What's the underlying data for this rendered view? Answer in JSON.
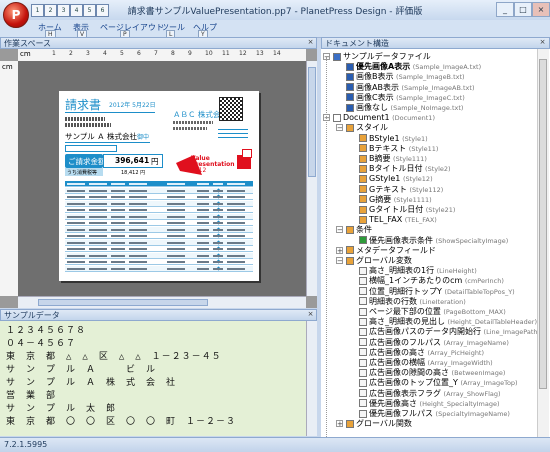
{
  "window": {
    "title": "請求書サンプルValuePresentation.pp7 - PlanetPress Design - 評価版",
    "quick_access": [
      "1",
      "2",
      "3",
      "4",
      "5",
      "6"
    ],
    "controls": [
      "_",
      "□",
      "×"
    ]
  },
  "ribbon": {
    "tabs": [
      {
        "label": "ホーム",
        "key": "H"
      },
      {
        "label": "表示",
        "key": "V"
      },
      {
        "label": "ページレイアウト",
        "key": "P"
      },
      {
        "label": "ツール",
        "key": "L"
      },
      {
        "label": "ヘルプ",
        "key": "Y"
      }
    ]
  },
  "workspace": {
    "title": "作業スペース",
    "ruler_unit": "cm",
    "ruler_marks": [
      "1",
      "2",
      "3",
      "4",
      "5",
      "6",
      "7",
      "8",
      "9",
      "10",
      "11",
      "12",
      "13",
      "14"
    ]
  },
  "invoice": {
    "title": "請求書",
    "date": "2012年 5月22日",
    "company": "ＡＢＣ 株式会社",
    "customer": "サンプル Ａ 株式会社",
    "honorific": "御中",
    "total_label": "ご請求金額",
    "total_value": "396,641",
    "total_unit": "円",
    "tax_label": "うち消費税等",
    "tax_value": "18,412 円",
    "brand_line1": "Value",
    "brand_line2": "Presentation",
    "brand_year": "2012"
  },
  "sample_data": {
    "title": "サンプルデータ",
    "lines": [
      "１２３４５６７８",
      "０４－４５６７",
      "東　京　都　△　△　区　△　△　１－２３－４５",
      "サ　ン　プ　ル　Ａ　　　ビ　ル",
      "サ　ン　プ　ル　Ａ　株　式　会　社",
      "営　業　部",
      "サ　ン　プ　ル　太　郎",
      "東　京　都　〇　〇　区　〇　〇　町　１－２－３"
    ]
  },
  "tree": {
    "title": "ドキュメント構造",
    "nodes": [
      {
        "label": "サンプルデータファイル",
        "sub": "",
        "level": 0,
        "icon": "folder-icon",
        "exp": "−"
      },
      {
        "label": "優先画像A表示",
        "sub": "(Sample_ImageA.txt)",
        "level": 1,
        "icon": "datafile-icon",
        "bold": true
      },
      {
        "label": "画像B表示",
        "sub": "(Sample_ImageB.txt)",
        "level": 1,
        "icon": "datafile-icon"
      },
      {
        "label": "画像AB表示",
        "sub": "(Sample_ImageAB.txt)",
        "level": 1,
        "icon": "datafile-icon"
      },
      {
        "label": "画像C表示",
        "sub": "(Sample_ImageC.txt)",
        "level": 1,
        "icon": "datafile-icon"
      },
      {
        "label": "画像なし",
        "sub": "(Sample_NoImage.txt)",
        "level": 1,
        "icon": "datafile-icon"
      },
      {
        "label": "Document1",
        "sub": "(Document1)",
        "level": 0,
        "icon": "document-icon",
        "exp": "−"
      },
      {
        "label": "スタイル",
        "sub": "",
        "level": 1,
        "icon": "style-folder-icon",
        "exp": "−"
      },
      {
        "label": "BStyle1",
        "sub": "(Style1)",
        "level": 2,
        "icon": "style-icon"
      },
      {
        "label": "Bテキスト",
        "sub": "(Style11)",
        "level": 2,
        "icon": "style-icon"
      },
      {
        "label": "B摘要",
        "sub": "(Style111)",
        "level": 2,
        "icon": "style-icon"
      },
      {
        "label": "Bタイトル日付",
        "sub": "(Style2)",
        "level": 2,
        "icon": "style-icon"
      },
      {
        "label": "GStyle1",
        "sub": "(Style12)",
        "level": 2,
        "icon": "style-icon"
      },
      {
        "label": "Gテキスト",
        "sub": "(Style112)",
        "level": 2,
        "icon": "style-icon"
      },
      {
        "label": "G摘要",
        "sub": "(Style1111)",
        "level": 2,
        "icon": "style-icon"
      },
      {
        "label": "Gタイトル日付",
        "sub": "(Style21)",
        "level": 2,
        "icon": "style-icon"
      },
      {
        "label": "TEL_FAX",
        "sub": "(TEL_FAX)",
        "level": 2,
        "icon": "style-icon"
      },
      {
        "label": "条件",
        "sub": "",
        "level": 1,
        "icon": "condition-folder-icon",
        "exp": "−"
      },
      {
        "label": "優先画像表示条件",
        "sub": "(ShowSpecialtyImage)",
        "level": 2,
        "icon": "condition-icon"
      },
      {
        "label": "メタデータフィールド",
        "sub": "",
        "level": 1,
        "icon": "metadata-folder-icon",
        "exp": "+"
      },
      {
        "label": "グローバル変数",
        "sub": "",
        "level": 1,
        "icon": "variable-folder-icon",
        "exp": "−"
      },
      {
        "label": "高さ_明細表の1行",
        "sub": "(LineHeight)",
        "level": 2,
        "icon": "variable-icon"
      },
      {
        "label": "横幅_1インチあたりのcm",
        "sub": "(cmPerInch)",
        "level": 2,
        "icon": "variable-icon"
      },
      {
        "label": "位置_明細行トップY",
        "sub": "(DetailTableTopPos_Y)",
        "level": 2,
        "icon": "variable-icon"
      },
      {
        "label": "明細表の行数",
        "sub": "(LineIteration)",
        "level": 2,
        "icon": "variable-icon"
      },
      {
        "label": "ページ最下部の位置",
        "sub": "(PageBottom_MAX)",
        "level": 2,
        "icon": "variable-icon"
      },
      {
        "label": "高さ_明細表の見出し",
        "sub": "(Height_DetailTableHeader)",
        "level": 2,
        "icon": "variable-icon"
      },
      {
        "label": "広告画像パスのデータ内開始行",
        "sub": "(Line_ImagePathS",
        "level": 2,
        "icon": "variable-icon"
      },
      {
        "label": "広告画像のフルパス",
        "sub": "(Array_ImageName)",
        "level": 2,
        "icon": "variable-icon"
      },
      {
        "label": "広告画像の高さ",
        "sub": "(Array_PicHeight)",
        "level": 2,
        "icon": "variable-icon"
      },
      {
        "label": "広告画像の横幅",
        "sub": "(Array_ImageWidth)",
        "level": 2,
        "icon": "variable-icon"
      },
      {
        "label": "広告画像の隙間の高さ",
        "sub": "(BetweenImage)",
        "level": 2,
        "icon": "variable-icon"
      },
      {
        "label": "広告画像のトップ位置_Y",
        "sub": "(Array_ImageTop)",
        "level": 2,
        "icon": "variable-icon"
      },
      {
        "label": "広告画像表示フラグ",
        "sub": "(Array_ShowFlag)",
        "level": 2,
        "icon": "variable-icon"
      },
      {
        "label": "優先画像高さ",
        "sub": "(Height_SpecialtyImage)",
        "level": 2,
        "icon": "variable-icon"
      },
      {
        "label": "優先画像フルパス",
        "sub": "(SpecialtyImageName)",
        "level": 2,
        "icon": "variable-icon"
      },
      {
        "label": "グローバル関数",
        "sub": "",
        "level": 1,
        "icon": "function-folder-icon",
        "exp": "+"
      }
    ]
  },
  "status": {
    "version": "7.2.1.5995"
  },
  "colors": {
    "accent": "#1d8ec9",
    "ribbon": "#d4e2f3",
    "sample_bg": "#e4f0d6",
    "brand_red": "#e0101e"
  }
}
